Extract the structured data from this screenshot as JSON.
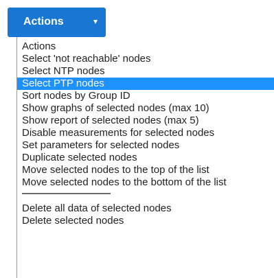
{
  "actions_button": {
    "label": "Actions",
    "caret_icon": "caret-down-icon"
  },
  "colors": {
    "button_bg": "#1976d2",
    "selected_bg": "#1e90ff",
    "text": "#222222"
  },
  "menu": {
    "selected_index": 3,
    "items_before_separator": [
      "Actions",
      "Select 'not reachable' nodes",
      "Select NTP nodes",
      "Select PTP nodes",
      "Sort nodes by Group ID",
      "Show graphs of selected nodes (max 10)",
      "Show report of selected nodes (max 5)",
      "Disable measurements for selected nodes",
      "Set parameters for selected nodes",
      "Duplicate selected nodes",
      "Move selected nodes to the top of the list",
      "Move selected nodes to the bottom of the list"
    ],
    "items_after_separator": [
      "Delete all data of selected nodes",
      "Delete selected nodes"
    ]
  }
}
